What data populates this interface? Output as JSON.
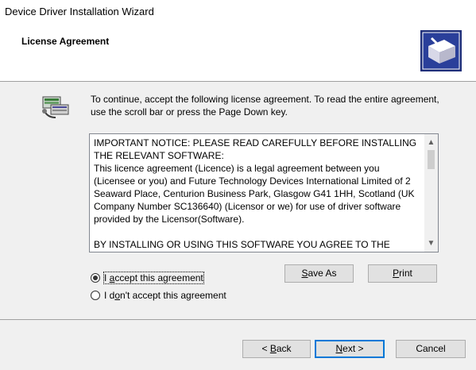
{
  "window": {
    "title": "Device Driver Installation Wizard"
  },
  "header": {
    "heading": "License Agreement",
    "icon": "installer-icon"
  },
  "intro": {
    "icon": "license-install-icon",
    "text": "To continue, accept the following license agreement. To read the entire agreement, use the scroll bar or press the Page Down key."
  },
  "license": {
    "text": "IMPORTANT NOTICE: PLEASE READ CAREFULLY BEFORE INSTALLING THE RELEVANT SOFTWARE:\nThis licence agreement (Licence) is a legal agreement between you (Licensee or you) and Future Technology Devices International Limited of 2 Seaward Place, Centurion Business Park, Glasgow G41 1HH, Scotland (UK Company Number SC136640) (Licensor or we) for use of driver software provided by the Licensor(Software).\n\nBY INSTALLING OR USING THIS SOFTWARE YOU AGREE TO THE",
    "scroll_up": "▲",
    "scroll_down": "▼"
  },
  "options": {
    "accept_label_prefix": "I ",
    "accept_label_underlined": "a",
    "accept_label_rest": "ccept this agreement",
    "decline_label_prefix": "I d",
    "decline_label_underlined": "o",
    "decline_label_rest": "n't accept this agreement",
    "selected": "accept"
  },
  "buttons": {
    "save_as_underlined": "S",
    "save_as_rest": "ave As",
    "print_underlined": "P",
    "print_rest": "rint",
    "back_prefix": "< ",
    "back_underlined": "B",
    "back_rest": "ack",
    "next_underlined": "N",
    "next_rest": "ext >",
    "cancel": "Cancel"
  }
}
